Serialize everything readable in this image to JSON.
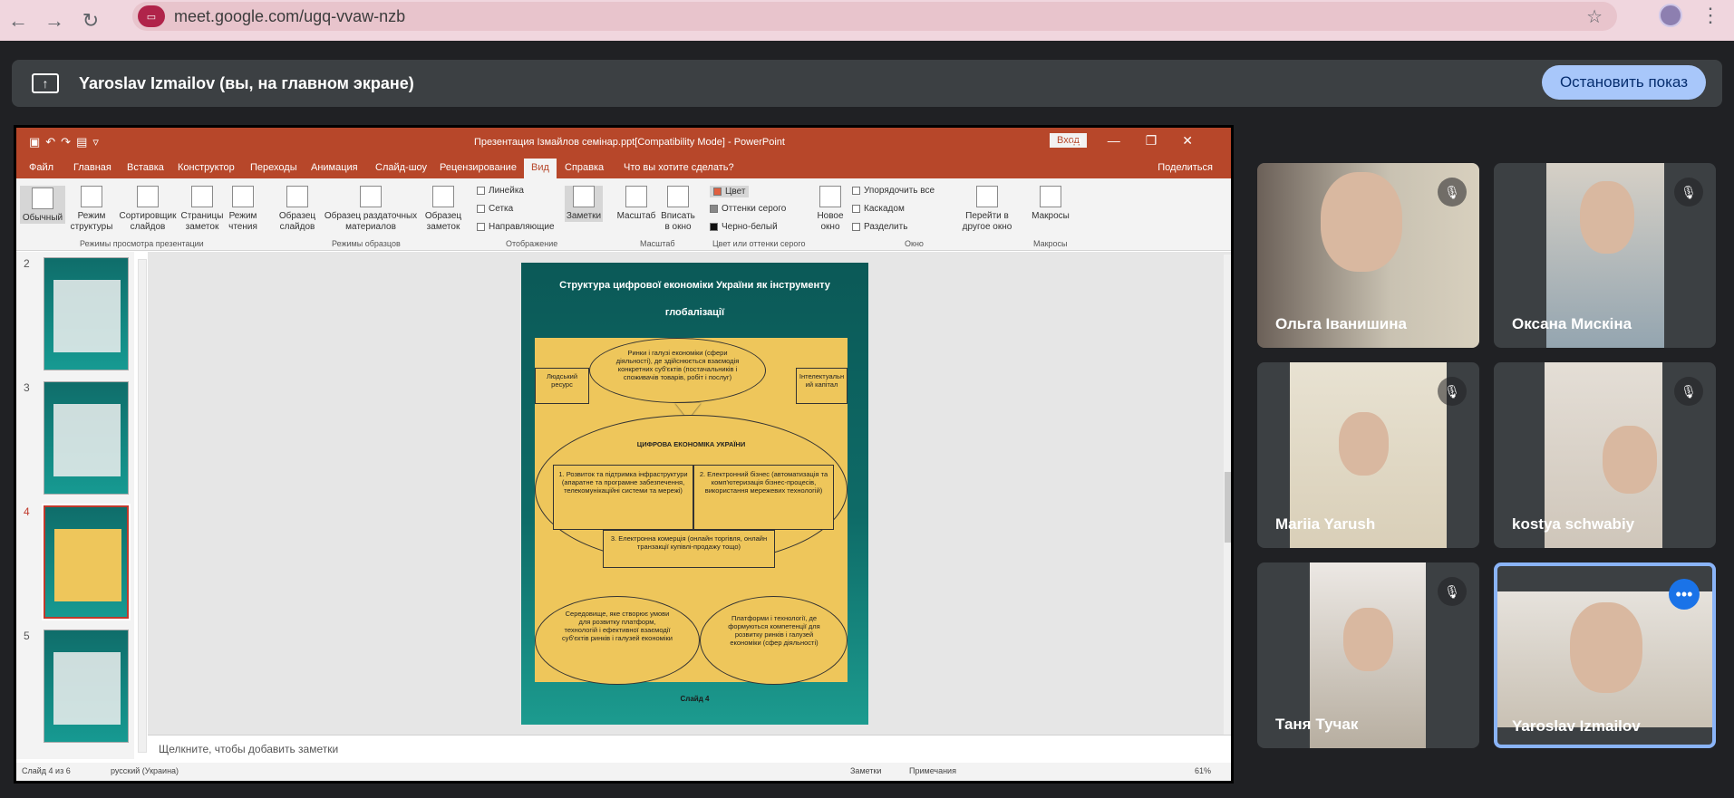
{
  "browser": {
    "url": "meet.google.com/ugq-vvaw-nzb"
  },
  "share_bar": {
    "title": "Yaroslav Izmailov (вы, на главном экране)",
    "stop_label": "Остановить показ"
  },
  "powerpoint": {
    "window_title": "Презентация Ізмайлов семінар.ppt[Compatibility Mode]  -  PowerPoint",
    "login_label": "Вход",
    "tabs": [
      "Файл",
      "Главная",
      "Вставка",
      "Конструктор",
      "Переходы",
      "Анимация",
      "Слайд-шоу",
      "Рецензирование",
      "Вид",
      "Справка",
      "Что вы хотите сделать?"
    ],
    "share_label": "Поделиться",
    "ribbon": {
      "normal": "Обычный",
      "structure": "Режим структуры",
      "sorter": "Сортировщик слайдов",
      "notes_page": "Страницы заметок",
      "reading": "Режим чтения",
      "group_view": "Режимы просмотра презентации",
      "slide_master": "Образец слайдов",
      "handout_master": "Образец раздаточных материалов",
      "notes_master": "Образец заметок",
      "group_master": "Режимы образцов",
      "ruler": "Линейка",
      "grid": "Сетка",
      "guides": "Направляющие",
      "group_show": "Отображение",
      "notes": "Заметки",
      "zoom": "Масштаб",
      "fit": "Вписать в окно",
      "group_zoom": "Масштаб",
      "color": "Цвет",
      "grayscale": "Оттенки серого",
      "bw": "Черно-белый",
      "group_color": "Цвет или оттенки серого",
      "new_window": "Новое окно",
      "arrange": "Упорядочить все",
      "cascade": "Каскадом",
      "split": "Разделить",
      "switch": "Перейти в другое окно",
      "group_window": "Окно",
      "macros": "Макросы",
      "group_macros": "Макросы"
    },
    "thumbs": [
      "2",
      "3",
      "4",
      "5"
    ],
    "slide": {
      "title1": "Структура цифрової економіки України як інструменту",
      "title2": "глобалізації",
      "markets": "Ринки і галузі економіки (сфери діяльності), де здійснюється взаємодія конкретних суб'єктів (постачальників і споживачів товарів, робіт і послуг)",
      "human": "Людський ресурс",
      "intel": "Інтелектуальн ий капітал",
      "digital": "ЦИФРОВА ЕКОНОМІКА УКРАЇНИ",
      "box1": "1. Розвиток та підтримка інфраструктури (апаратне та програмне забезпечення, телекомунікаційні системи та мережі)",
      "box2": "2. Електронний бізнес (автоматизація та комп'ютеризація бізнес-процесів, використання мережевих технологій)",
      "box3": "3. Електронна комерція (онлайн торгівля, онлайн транзакції купівлі-продажу тощо)",
      "env": "Середовище, яке створює умови для розвитку платформ, технологій і ефективної взаємодії суб'єктів ринків і галузей економіки",
      "platforms": "Платформи і технології, де формуються компетенції для розвитку ринків і галузей економіки (сфер діяльності)",
      "num": "Слайд 4"
    },
    "notes_placeholder": "Щелкните, чтобы добавить заметки",
    "status": {
      "slide": "Слайд 4 из 6",
      "lang": "русский (Украина)",
      "notes": "Заметки",
      "comments": "Примечания",
      "zoom": "61%"
    }
  },
  "participants": [
    {
      "name": "Ольга Іванишина",
      "muted": true
    },
    {
      "name": "Оксана Мискіна",
      "muted": true
    },
    {
      "name": "Mariia Yarush",
      "muted": true
    },
    {
      "name": "kostya schwabiy",
      "muted": true
    },
    {
      "name": "Таня Тучак",
      "muted": true
    },
    {
      "name": "Yaroslav Izmailov",
      "muted": false
    }
  ]
}
